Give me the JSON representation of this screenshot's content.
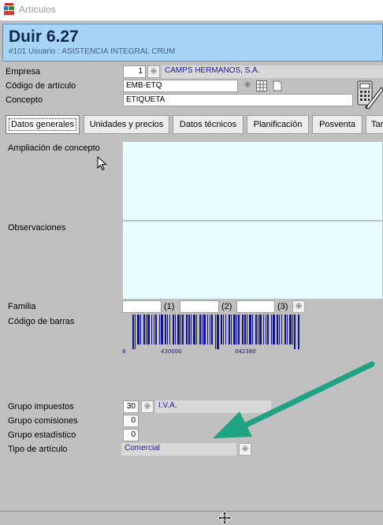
{
  "window": {
    "title": "Artículos"
  },
  "header": {
    "title": "Duir 6.27",
    "subtitle": "#101 Usuario : ASISTENCIA INTEGRAL CRUM"
  },
  "form": {
    "empresa": {
      "label": "Empresa",
      "value": "1",
      "description": "CAMPS HERMANOS, S.A."
    },
    "codigo": {
      "label": "Código de artículo",
      "value": "EMB-ETQ"
    },
    "concepto": {
      "label": "Concepto",
      "value": "ETIQUETA"
    }
  },
  "tabs": [
    {
      "label": "Datos generales"
    },
    {
      "label": "Unidades y precios"
    },
    {
      "label": "Datos técnicos"
    },
    {
      "label": "Planificación"
    },
    {
      "label": "Posventa"
    },
    {
      "label": "Tar"
    }
  ],
  "general": {
    "ampliacion_label": "Ampliación de concepto",
    "observaciones_label": "Observaciones",
    "familia": {
      "label": "Familia",
      "suffix1": "(1)",
      "suffix2": "(2)",
      "suffix3": "(3)"
    },
    "barcode": {
      "label": "Código de barras",
      "d1": "8",
      "d2": "430000",
      "d3": "042380"
    },
    "grupo_impuestos": {
      "label": "Grupo impuestos",
      "value": "30",
      "description": "I.V.A."
    },
    "grupo_comisiones": {
      "label": "Grupo comisiones",
      "value": "0"
    },
    "grupo_estadistico": {
      "label": "Grupo estadístico",
      "value": "0"
    },
    "tipo_articulo": {
      "label": "Tipo de artículo",
      "value": "Comercial"
    }
  },
  "colors": {
    "header_bg": "#a8d4f6",
    "memo_bg": "#e8fdfe",
    "arrow": "#1fa383",
    "barcode": "#13138a",
    "link_text": "#1a1a9c"
  },
  "icons": [
    "app-icon",
    "picker-icon",
    "grid-icon",
    "page-icon",
    "calculator-edit-icon",
    "cursor-icon",
    "move-cursor-icon"
  ]
}
